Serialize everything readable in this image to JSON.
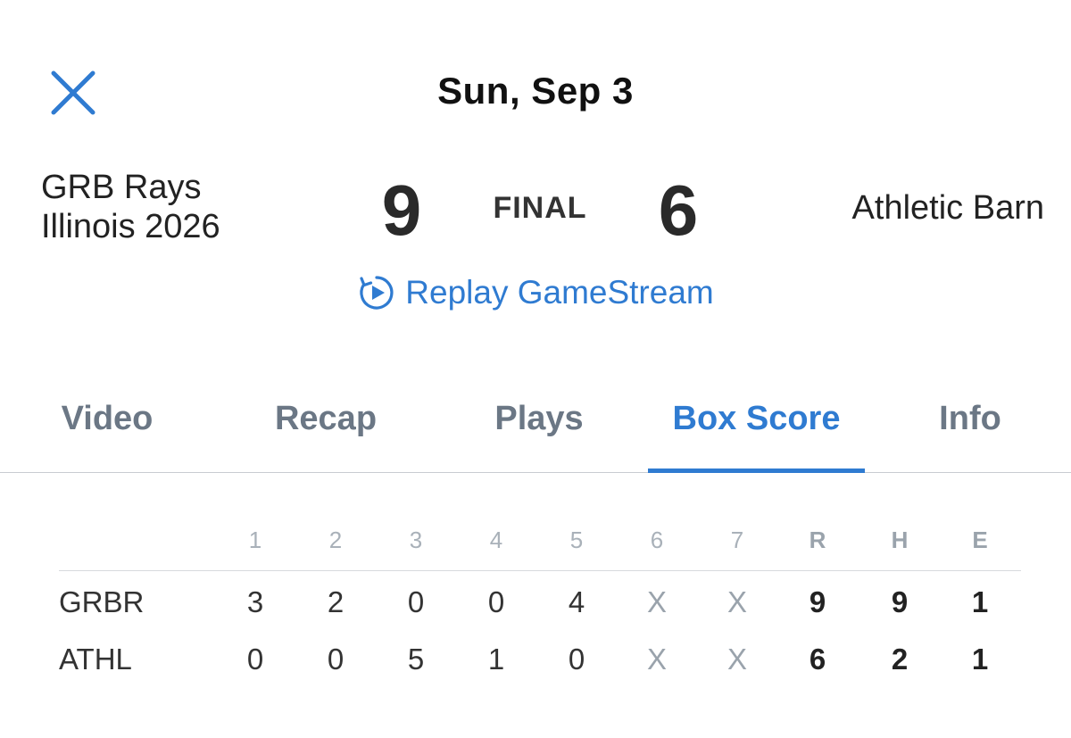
{
  "header": {
    "date": "Sun, Sep 3"
  },
  "game": {
    "away_team_line1": "GRB Rays",
    "away_team_line2": "Illinois 2026",
    "away_score": "9",
    "status": "FINAL",
    "home_score": "6",
    "home_team": "Athletic Barn",
    "replay_label": "Replay GameStream"
  },
  "tabs": [
    {
      "label": "Video"
    },
    {
      "label": "Recap"
    },
    {
      "label": "Plays"
    },
    {
      "label": "Box Score",
      "active": true
    },
    {
      "label": "Info"
    }
  ],
  "box_score": {
    "columns": [
      "1",
      "2",
      "3",
      "4",
      "5",
      "6",
      "7",
      "R",
      "H",
      "E"
    ],
    "rows": [
      {
        "team": "GRBR",
        "innings": [
          "3",
          "2",
          "0",
          "0",
          "4",
          "X",
          "X"
        ],
        "R": "9",
        "H": "9",
        "E": "1"
      },
      {
        "team": "ATHL",
        "innings": [
          "0",
          "0",
          "5",
          "1",
          "0",
          "X",
          "X"
        ],
        "R": "6",
        "H": "2",
        "E": "1"
      }
    ]
  },
  "colors": {
    "accent": "#2f7bd1",
    "tab_inactive": "#6b7785",
    "muted": "#9aa3ac"
  },
  "icons": {
    "close": "close-icon",
    "replay": "replay-play-icon"
  }
}
